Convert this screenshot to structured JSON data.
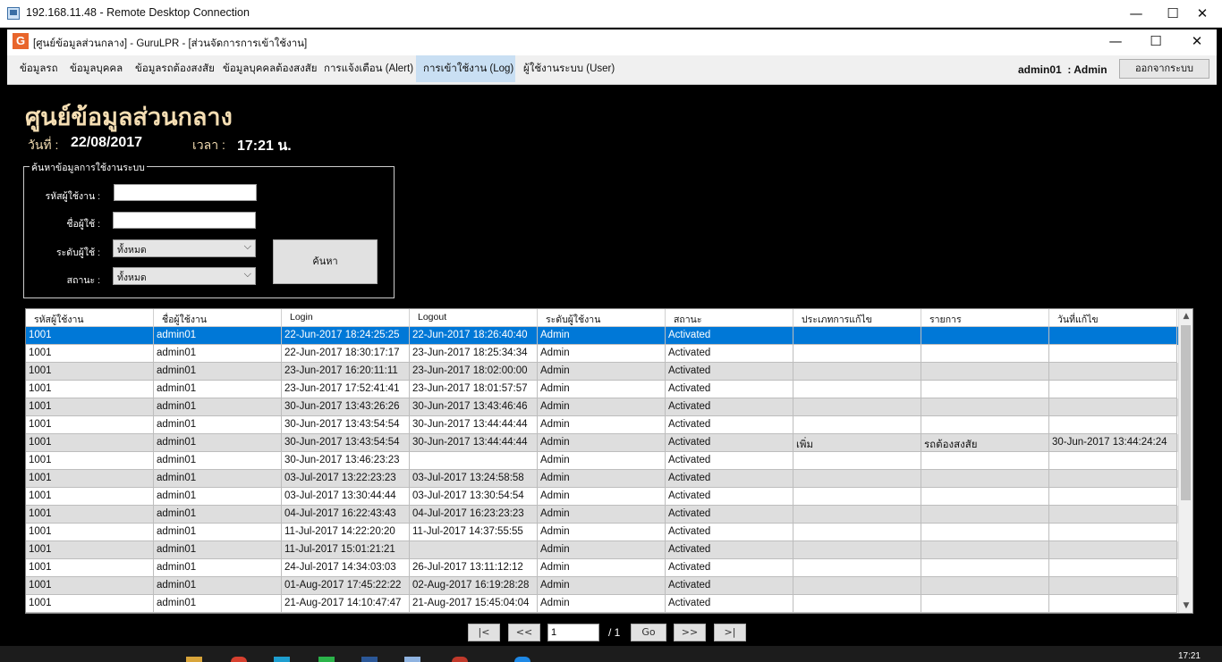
{
  "rdp_window": {
    "title": "192.168.11.48 - Remote Desktop Connection",
    "buttons": {
      "minimize": "—",
      "maximize": "☐",
      "close": "✕"
    }
  },
  "app_window": {
    "title": "[ศูนย์ข้อมูลส่วนกลาง] - GuruLPR - [ส่วนจัดการการเข้าใช้งาน]",
    "icon_letter": "G",
    "buttons": {
      "minimize": "—",
      "maximize": "☐",
      "close": "✕"
    }
  },
  "menu": {
    "items": [
      {
        "label": "ข้อมูลรถ"
      },
      {
        "label": "ข้อมูลบุคคล"
      },
      {
        "label": "ข้อมูลรถต้องสงสัย"
      },
      {
        "label": "ข้อมูลบุคคลต้องสงสัย"
      },
      {
        "label": "การแจ้งเตือน (Alert)"
      },
      {
        "label": "การเข้าใช้งาน (Log)",
        "active": true
      },
      {
        "label": "ผู้ใช้งานระบบ (User)"
      }
    ],
    "user_name": "admin01",
    "user_role": ": Admin",
    "logout_label": "ออกจากระบบ"
  },
  "header": {
    "title": "ศูนย์ข้อมูลส่วนกลาง",
    "date_label": "วันที่ :",
    "date_value": "22/08/2017",
    "time_label": "เวลา :",
    "time_value": "17:21 น."
  },
  "search": {
    "legend": "ค้นหาข้อมูลการใช้งานระบบ",
    "user_id_label": "รหัสผู้ใช้งาน :",
    "user_id_value": "",
    "username_label": "ชื่อผู้ใช้ :",
    "username_value": "",
    "level_label": "ระดับผู้ใช้ :",
    "level_value": "ทั้งหมด",
    "status_label": "สถานะ :",
    "status_value": "ทั้งหมด",
    "search_button": "ค้นหา"
  },
  "table": {
    "columns": [
      "รหัสผู้ใช้งาน",
      "ชื่อผู้ใช้งาน",
      "Login",
      "Logout",
      "ระดับผู้ใช้งาน",
      "สถานะ",
      "ประเภทการแก้ไข",
      "รายการ",
      "วันที่แก้ไข"
    ],
    "rows": [
      [
        "1001",
        "admin01",
        "22-Jun-2017 18:24:25:25",
        "22-Jun-2017 18:26:40:40",
        "Admin",
        "Activated",
        "",
        "",
        ""
      ],
      [
        "1001",
        "admin01",
        "22-Jun-2017 18:30:17:17",
        "23-Jun-2017 18:25:34:34",
        "Admin",
        "Activated",
        "",
        "",
        ""
      ],
      [
        "1001",
        "admin01",
        "23-Jun-2017 16:20:11:11",
        "23-Jun-2017 18:02:00:00",
        "Admin",
        "Activated",
        "",
        "",
        ""
      ],
      [
        "1001",
        "admin01",
        "23-Jun-2017 17:52:41:41",
        "23-Jun-2017 18:01:57:57",
        "Admin",
        "Activated",
        "",
        "",
        ""
      ],
      [
        "1001",
        "admin01",
        "30-Jun-2017 13:43:26:26",
        "30-Jun-2017 13:43:46:46",
        "Admin",
        "Activated",
        "",
        "",
        ""
      ],
      [
        "1001",
        "admin01",
        "30-Jun-2017 13:43:54:54",
        "30-Jun-2017 13:44:44:44",
        "Admin",
        "Activated",
        "",
        "",
        ""
      ],
      [
        "1001",
        "admin01",
        "30-Jun-2017 13:43:54:54",
        "30-Jun-2017 13:44:44:44",
        "Admin",
        "Activated",
        "เพิ่ม",
        "รถต้องสงสัย",
        "30-Jun-2017 13:44:24:24"
      ],
      [
        "1001",
        "admin01",
        "30-Jun-2017 13:46:23:23",
        "",
        "Admin",
        "Activated",
        "",
        "",
        ""
      ],
      [
        "1001",
        "admin01",
        "03-Jul-2017 13:22:23:23",
        "03-Jul-2017 13:24:58:58",
        "Admin",
        "Activated",
        "",
        "",
        ""
      ],
      [
        "1001",
        "admin01",
        "03-Jul-2017 13:30:44:44",
        "03-Jul-2017 13:30:54:54",
        "Admin",
        "Activated",
        "",
        "",
        ""
      ],
      [
        "1001",
        "admin01",
        "04-Jul-2017 16:22:43:43",
        "04-Jul-2017 16:23:23:23",
        "Admin",
        "Activated",
        "",
        "",
        ""
      ],
      [
        "1001",
        "admin01",
        "11-Jul-2017 14:22:20:20",
        "11-Jul-2017 14:37:55:55",
        "Admin",
        "Activated",
        "",
        "",
        ""
      ],
      [
        "1001",
        "admin01",
        "11-Jul-2017 15:01:21:21",
        "",
        "Admin",
        "Activated",
        "",
        "",
        ""
      ],
      [
        "1001",
        "admin01",
        "24-Jul-2017 14:34:03:03",
        "26-Jul-2017 13:11:12:12",
        "Admin",
        "Activated",
        "",
        "",
        ""
      ],
      [
        "1001",
        "admin01",
        "01-Aug-2017 17:45:22:22",
        "02-Aug-2017 16:19:28:28",
        "Admin",
        "Activated",
        "",
        "",
        ""
      ],
      [
        "1001",
        "admin01",
        "21-Aug-2017 14:10:47:47",
        "21-Aug-2017 15:45:04:04",
        "Admin",
        "Activated",
        "",
        "",
        ""
      ]
    ]
  },
  "pager": {
    "first": "|<",
    "prev": "<<",
    "page_value": "1",
    "total": "/ 1",
    "go": "Go",
    "next": ">>",
    "last": ">|"
  },
  "taskbar": {
    "clock": "17:21"
  },
  "colors": {
    "heading": "#f5deb3",
    "selection": "#0078d7",
    "active_menu": "#c9dff3"
  }
}
